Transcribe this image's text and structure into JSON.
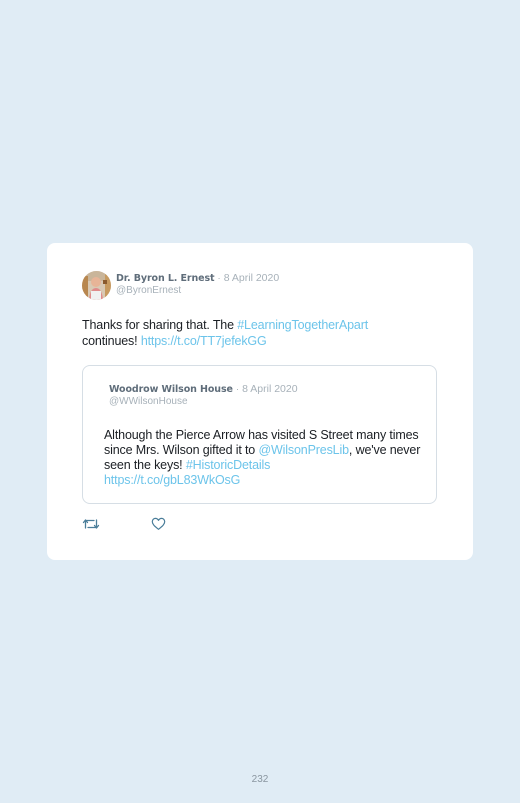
{
  "tweet": {
    "author_name": "Dr. Byron L. Ernest",
    "separator": "·",
    "date": "8 April 2020",
    "handle": "@ByronErnest",
    "text_1": "Thanks for sharing that. The ",
    "hashtag": "#LearningTogetherApart",
    "text_2": " continues! ",
    "link": "https://t.co/TT7jefekGG"
  },
  "quoted_tweet": {
    "author_name": "Woodrow Wilson House",
    "separator": "·",
    "date": "8 April 2020",
    "handle": "@WWilsonHouse",
    "text_1": "Although the Pierce Arrow has visited S Street many times since Mrs. Wilson gifted it to ",
    "mention": "@WilsonPresLib",
    "text_2": ", we've never seen the keys! ",
    "hashtag": "#HistoricDetails",
    "link": "https://t.co/gbL83WkOsG"
  },
  "actions": {
    "retweet_icon": "retweet-icon",
    "like_icon": "heart-icon"
  },
  "page": {
    "number": "232"
  },
  "colors": {
    "background": "#e0ecf5",
    "card": "#ffffff",
    "link": "#6cc4ea",
    "author": "#5f6d7a",
    "muted": "#a7b1b9"
  }
}
